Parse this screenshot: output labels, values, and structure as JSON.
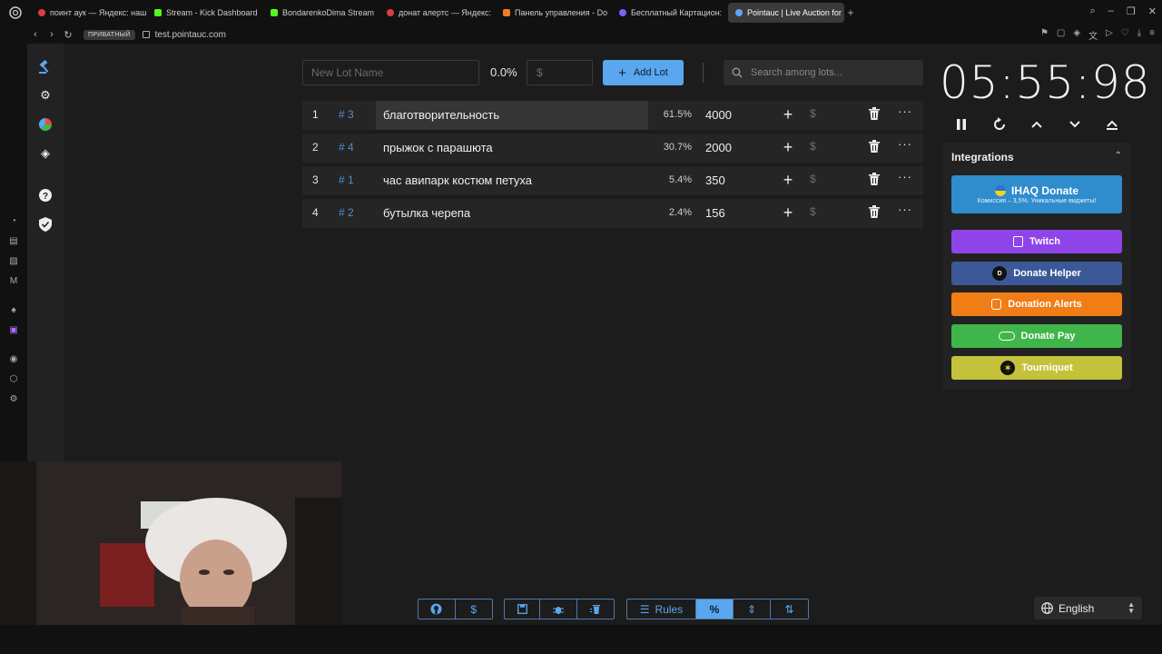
{
  "browser": {
    "tabs": [
      {
        "label": "поинт аук — Яндекс: наш",
        "color": "#e03b3b"
      },
      {
        "label": "Stream - Kick Dashboard",
        "color": "#53fc18"
      },
      {
        "label": "BondarenkoDima Stream",
        "color": "#53fc18"
      },
      {
        "label": "донат алертс — Яндекс:",
        "color": "#e03b3b"
      },
      {
        "label": "Панель управления - Do",
        "color": "#f57c20"
      },
      {
        "label": "Бесплатный Картацион:",
        "color": "#7b61ff"
      },
      {
        "label": "Pointauc | Live Auction for",
        "color": "#5aa6ef"
      }
    ],
    "private_badge": "ПРИВАТНЫЙ",
    "url": "test.pointauc.com"
  },
  "toolbar": {
    "lot_name_placeholder": "New Lot Name",
    "percent": "0.0%",
    "amount_placeholder": "$",
    "add_lot_label": "Add Lot",
    "search_placeholder": "Search among lots..."
  },
  "lots": [
    {
      "index": "1",
      "hash": "# 3",
      "name": "благотворительность",
      "percent": "61.5%",
      "amount": "4000",
      "dollar": "$"
    },
    {
      "index": "2",
      "hash": "# 4",
      "name": "прыжок с парашюта",
      "percent": "30.7%",
      "amount": "2000",
      "dollar": "$"
    },
    {
      "index": "3",
      "hash": "# 1",
      "name": "час авипарк костюм петуха",
      "percent": "5.4%",
      "amount": "350",
      "dollar": "$"
    },
    {
      "index": "4",
      "hash": "# 2",
      "name": "бутылка черепа",
      "percent": "2.4%",
      "amount": "156",
      "dollar": "$"
    }
  ],
  "timer": {
    "value": "05:55:98"
  },
  "integrations": {
    "title": "Integrations",
    "ihaq": {
      "label": "IHAQ Donate",
      "sub": "Комиссия – 3,5%. Уникальные виджеты!"
    },
    "buttons": [
      {
        "label": "Twitch",
        "color": "#8e44e8"
      },
      {
        "label": "Donate Helper",
        "color": "#3b5998"
      },
      {
        "label": "Donation Alerts",
        "color": "#f07d16"
      },
      {
        "label": "Donate Pay",
        "color": "#3fb54a"
      },
      {
        "label": "Tourniquet",
        "color": "#c3c23a"
      }
    ]
  },
  "bottom": {
    "rules_label": "Rules",
    "percent_label": "%",
    "dollar_label": "$"
  },
  "language": {
    "selected": "English"
  }
}
